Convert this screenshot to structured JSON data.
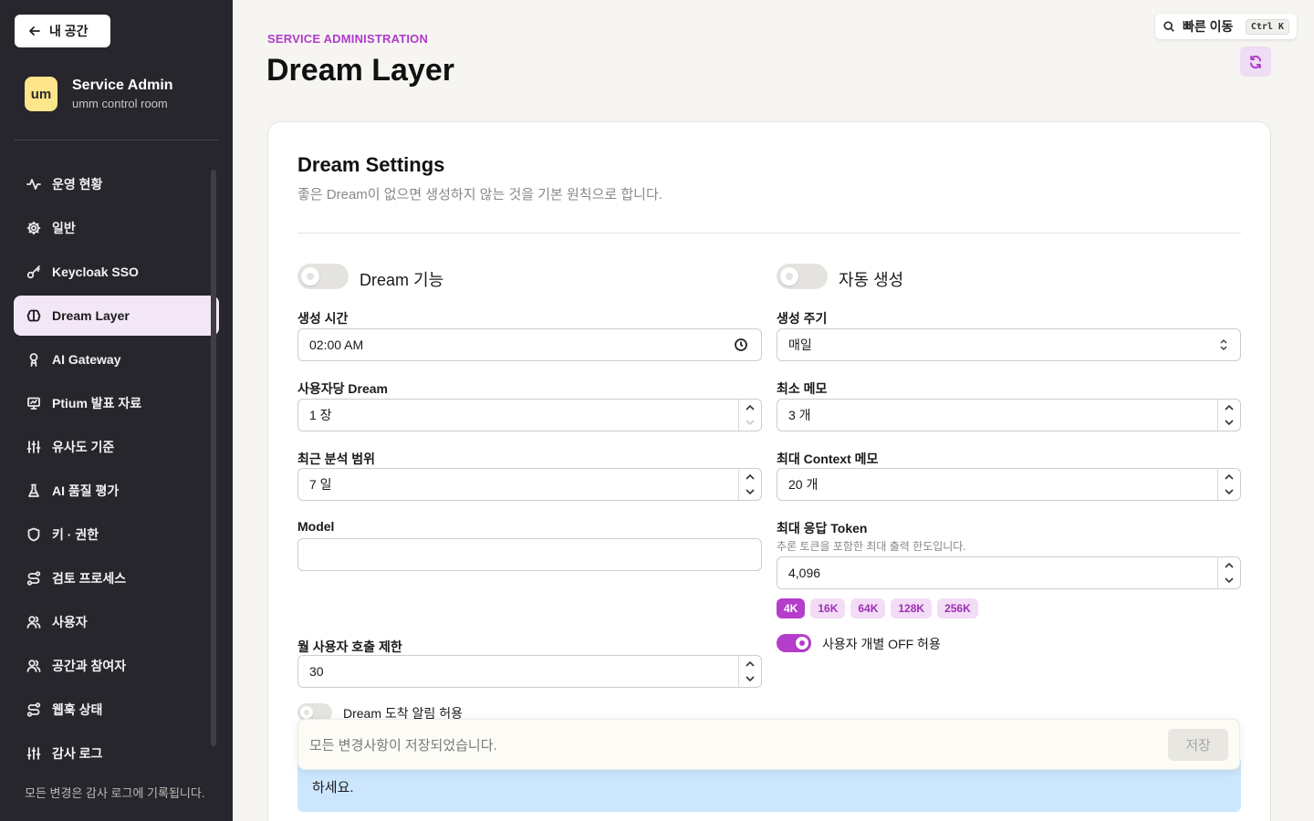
{
  "sidebar": {
    "back_label": "내 공간",
    "brand": {
      "logo": "um",
      "name": "Service Admin",
      "subtitle": "umm control room"
    },
    "items": [
      {
        "label": "운영 현황",
        "icon": "activity-icon"
      },
      {
        "label": "일반",
        "icon": "gear-icon"
      },
      {
        "label": "Keycloak SSO",
        "icon": "key-icon"
      },
      {
        "label": "Dream Layer",
        "icon": "brain-icon",
        "active": true
      },
      {
        "label": "AI Gateway",
        "icon": "bot-icon"
      },
      {
        "label": "Ptium 발표 자료",
        "icon": "presentation-icon"
      },
      {
        "label": "유사도 기준",
        "icon": "sliders-icon"
      },
      {
        "label": "AI 품질 평가",
        "icon": "flask-icon"
      },
      {
        "label": "키 · 권한",
        "icon": "shield-icon"
      },
      {
        "label": "검토 프로세스",
        "icon": "route-icon"
      },
      {
        "label": "사용자",
        "icon": "users-icon"
      },
      {
        "label": "공간과 참여자",
        "icon": "users-icon"
      },
      {
        "label": "웹훅 상태",
        "icon": "webhook-icon"
      },
      {
        "label": "감사 로그",
        "icon": "sliders-icon"
      }
    ],
    "footer": "모든 변경은 감사 로그에 기록됩니다."
  },
  "header": {
    "eyebrow": "SERVICE ADMINISTRATION",
    "title": "Dream Layer",
    "quick_jump": "빠른 이동",
    "quick_jump_kbd": "Ctrl K"
  },
  "settings": {
    "title": "Dream Settings",
    "description": "좋은 Dream이 없으면 생성하지 않는 것을 기본 원칙으로 합니다.",
    "dream_toggle": {
      "label": "Dream 기능",
      "on": false
    },
    "auto_toggle": {
      "label": "자동 생성",
      "on": false
    },
    "gen_time": {
      "label": "생성 시간",
      "value": "02:00 AM"
    },
    "gen_cycle": {
      "label": "생성 주기",
      "value": "매일"
    },
    "per_user": {
      "label": "사용자당 Dream",
      "value": "1 장"
    },
    "min_memo": {
      "label": "최소 메모",
      "value": "3 개"
    },
    "recent_range": {
      "label": "최근 분석 범위",
      "value": "7 일"
    },
    "max_context": {
      "label": "최대 Context 메모",
      "value": "20 개"
    },
    "model": {
      "label": "Model",
      "value": ""
    },
    "max_token": {
      "label": "최대 응답 Token",
      "hint": "추론 토큰을 포함한 최대 출력 한도입니다.",
      "value": "4,096"
    },
    "token_presets": [
      "4K",
      "16K",
      "64K",
      "128K",
      "256K"
    ],
    "token_preset_active": "4K",
    "user_off": {
      "label": "사용자 개별 OFF 허용",
      "on": true
    },
    "monthly_limit": {
      "label": "월 사용자 호출 제한",
      "value": "30"
    },
    "arrival_notify": {
      "label": "Dream 도착 알림 허용",
      "on": false
    },
    "info_text": "하세요."
  },
  "save_bar": {
    "status": "모든 변경사항이 저장되었습니다.",
    "save_label": "저장"
  },
  "colors": {
    "accent": "#b63dcc",
    "sidebar_bg": "#26262c",
    "info_bg": "#cbe6fd"
  }
}
